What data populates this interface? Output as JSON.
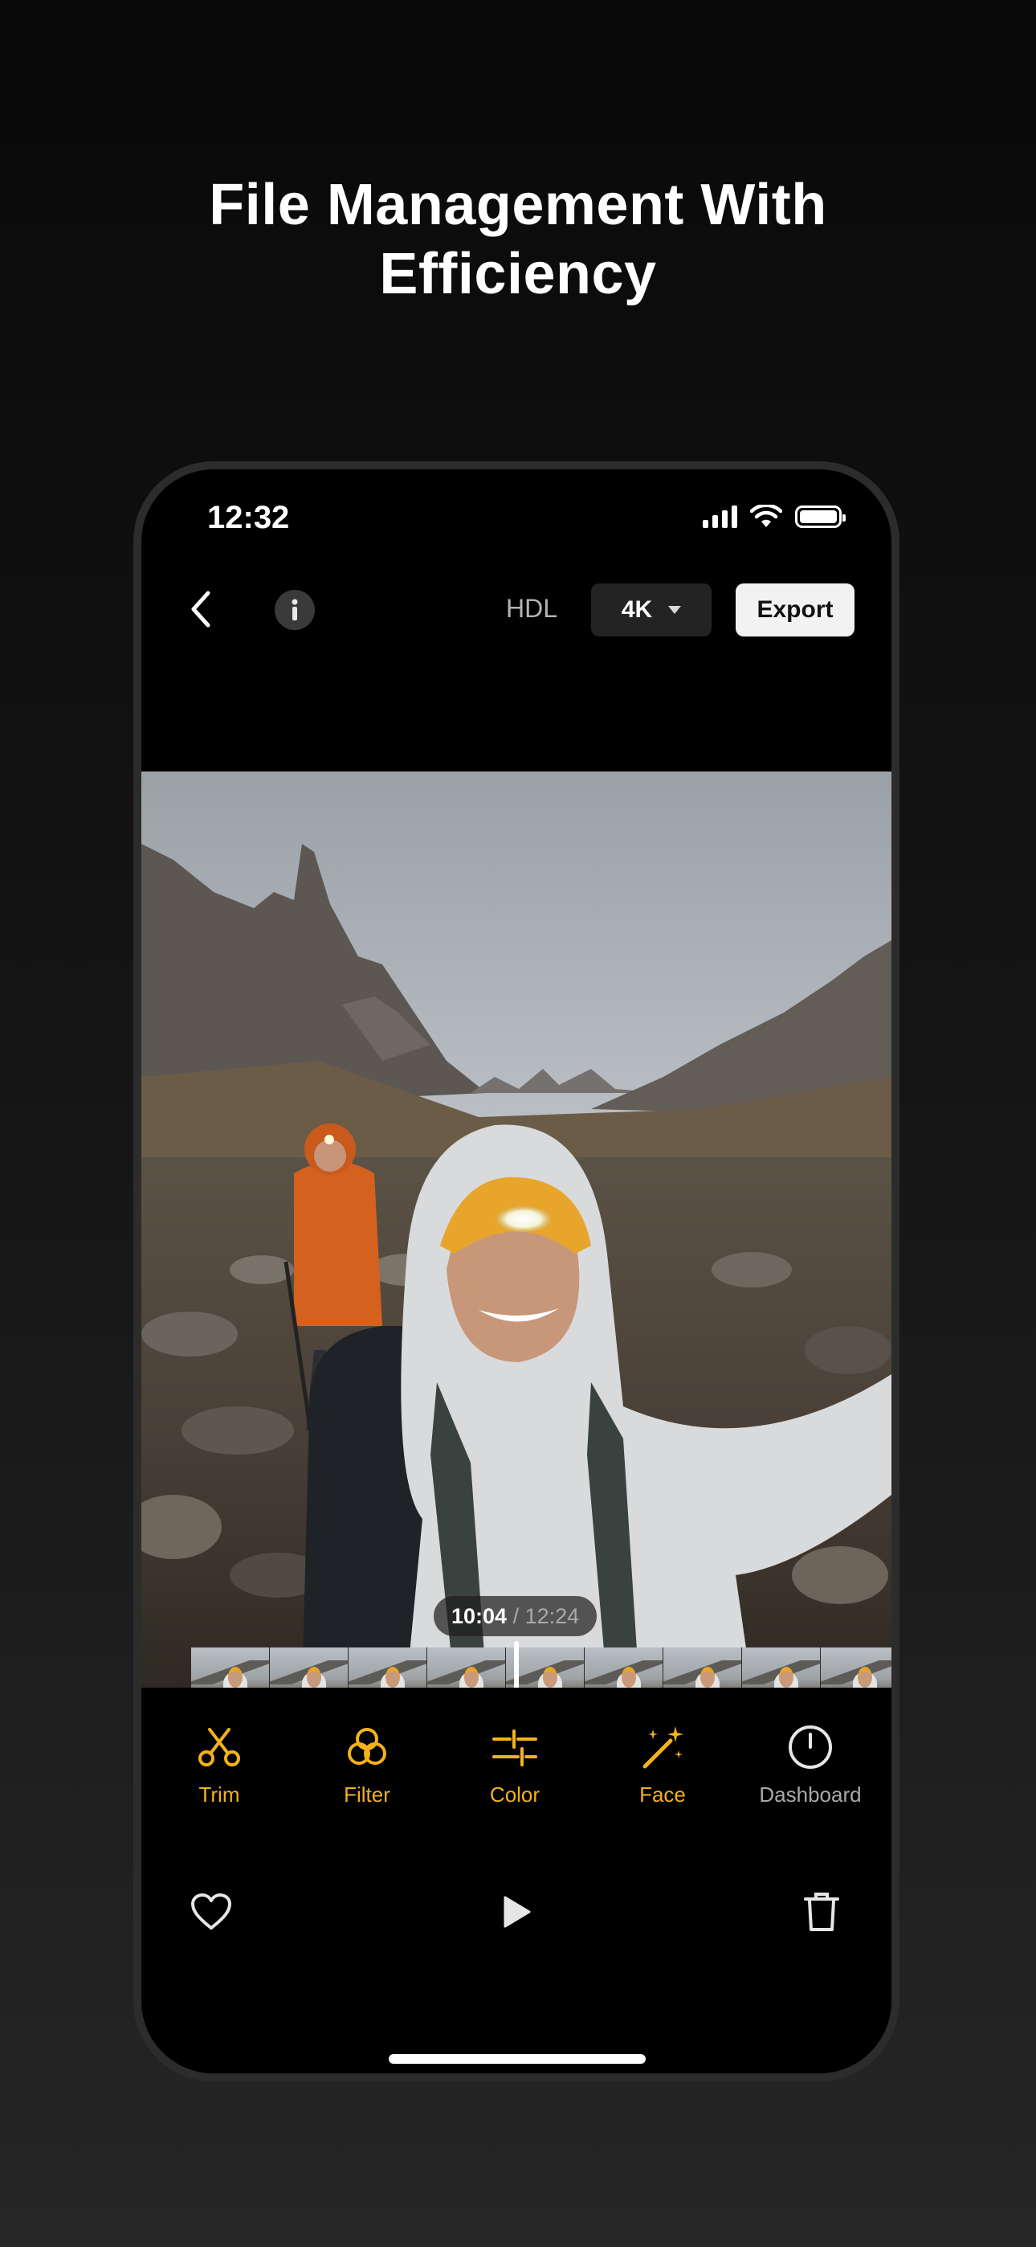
{
  "headline": {
    "line1": "File Management With",
    "line2": "Efficiency"
  },
  "status_bar": {
    "time": "12:32",
    "icons": [
      "cellular-signal-icon",
      "wifi-icon",
      "battery-icon"
    ]
  },
  "toolbar": {
    "title": "HDL",
    "resolution": "4K",
    "export_label": "Export",
    "icons": [
      "chevron-left-icon",
      "info-icon",
      "caret-down-icon"
    ]
  },
  "player": {
    "current_time": "10:04",
    "separator": " / ",
    "total_time": "12:24"
  },
  "tools": [
    {
      "label": "Trim",
      "icon": "scissors-icon",
      "color": "#f2b21b"
    },
    {
      "label": "Filter",
      "icon": "filter-circles-icon",
      "color": "#f2b21b"
    },
    {
      "label": "Color",
      "icon": "sliders-icon",
      "color": "#f2b21b"
    },
    {
      "label": "Face",
      "icon": "magic-wand-icon",
      "color": "#f2b21b"
    },
    {
      "label": "Dashboard",
      "icon": "gauge-icon",
      "color": "#a9a9a9"
    }
  ],
  "playback": {
    "icons": [
      "heart-icon",
      "play-icon",
      "trash-icon"
    ]
  },
  "colors": {
    "accent": "#f2b21b",
    "background": "#000000"
  }
}
